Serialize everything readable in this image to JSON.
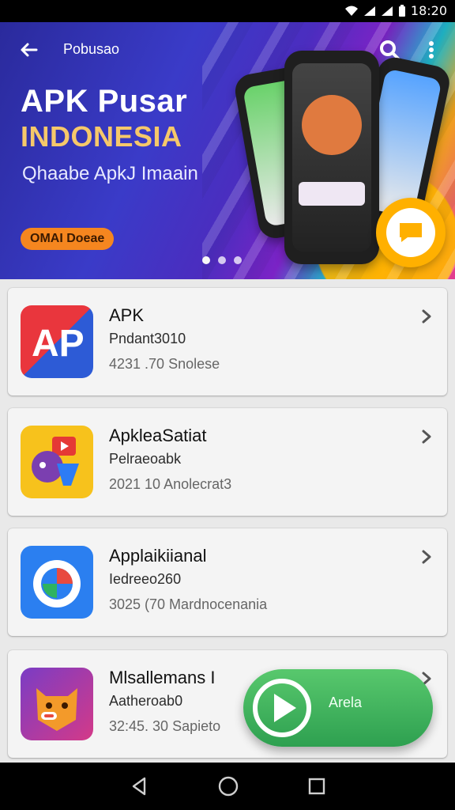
{
  "status_bar": {
    "time": "18:20"
  },
  "banner": {
    "top_label": "Pobusao",
    "title": "APK Pusar",
    "subtitle": "INDONESIA",
    "tagline": "Qhaabe ApkJ Imaain",
    "promo_pill": "OMAI Doeae",
    "colors": {
      "accent": "#f5861f",
      "title": "#ffffff",
      "subtitle": "#f6c86a"
    }
  },
  "apps": [
    {
      "name": "APK",
      "subtitle": "Pndant3010",
      "meta": "4231 .70 Snolese",
      "icon": "ap-icon"
    },
    {
      "name": "ApkleaSatiat",
      "subtitle": "Pelraeoabk",
      "meta": "2021 10 Anolecrat3",
      "icon": "youtube-puzzle-icon"
    },
    {
      "name": "Applaikiianal",
      "subtitle": "Iedreeo260",
      "meta": "3025 (70 Mardnocenania",
      "icon": "circle-swirl-icon"
    },
    {
      "name": "Mlsallemans I",
      "subtitle": "Aatheroab0",
      "meta": "32:45. 30 Sapieto",
      "icon": "fox-face-icon"
    }
  ],
  "fab": {
    "label": "Arela",
    "color": "#3bb057",
    "icon": "play-icon"
  },
  "nav_bar": {
    "back": "back-icon",
    "home": "home-icon",
    "recents": "recents-icon"
  }
}
